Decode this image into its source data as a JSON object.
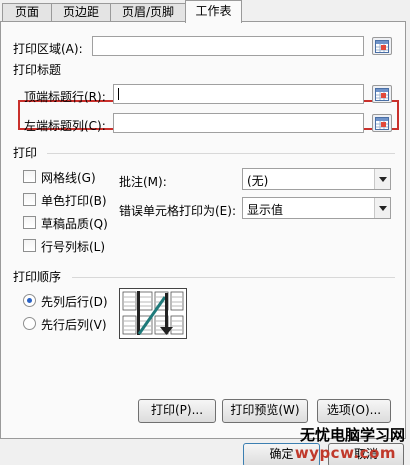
{
  "tabs": [
    {
      "label": "页面",
      "active": false
    },
    {
      "label": "页边距",
      "active": false
    },
    {
      "label": "页眉/页脚",
      "active": false
    },
    {
      "label": "工作表",
      "active": true
    }
  ],
  "print_area": {
    "label": "打印区域(A):",
    "value": ""
  },
  "print_titles": {
    "heading": "打印标题",
    "top_rows": {
      "label": "顶端标题行(R):",
      "value": ""
    },
    "left_cols": {
      "label": "左端标题列(C):",
      "value": ""
    }
  },
  "print": {
    "heading": "打印",
    "options": [
      {
        "label": "网格线(G)",
        "checked": false
      },
      {
        "label": "单色打印(B)",
        "checked": false
      },
      {
        "label": "草稿品质(Q)",
        "checked": false
      },
      {
        "label": "行号列标(L)",
        "checked": false
      }
    ],
    "comments": {
      "label": "批注(M):",
      "value": "(无)"
    },
    "cell_errors": {
      "label": "错误单元格打印为(E):",
      "value": "显示值"
    }
  },
  "page_order": {
    "heading": "打印顺序",
    "options": [
      {
        "label": "先列后行(D)",
        "selected": true
      },
      {
        "label": "先行后列(V)",
        "selected": false
      }
    ]
  },
  "buttons": {
    "print": "打印(P)...",
    "preview": "打印预览(W)",
    "options": "选项(O)..."
  },
  "footer": {
    "ok": "确定",
    "cancel": "取消"
  },
  "watermark": {
    "text": "无忧电脑学习网",
    "url": "wypcw.com"
  },
  "icons": {
    "range_picker": "collapse-dialog-icon",
    "order_preview": "page-order-diagram-icon"
  }
}
